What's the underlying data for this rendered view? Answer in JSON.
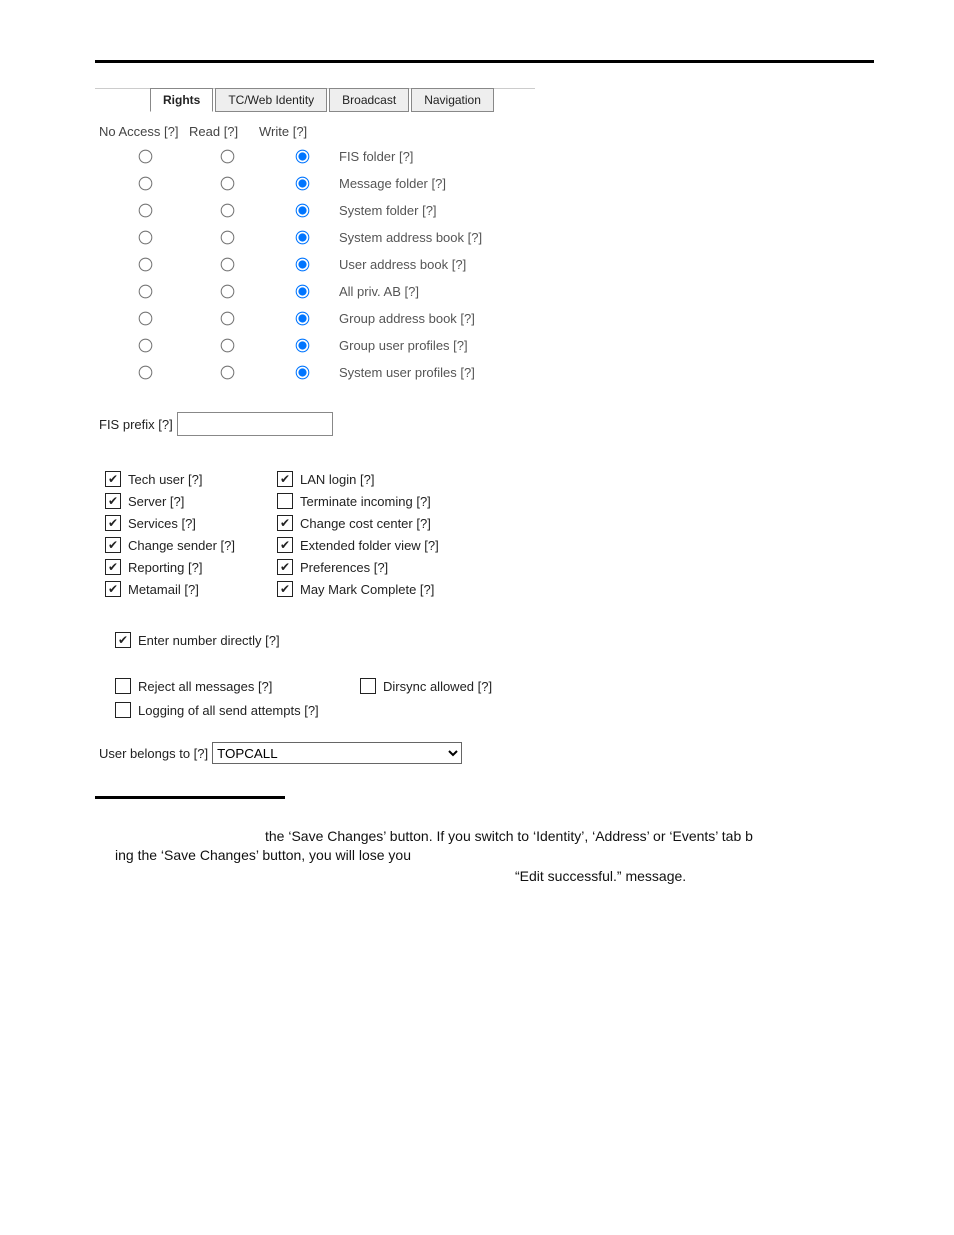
{
  "tabs": {
    "rights": "Rights",
    "identity": "TC/Web Identity",
    "broadcast": "Broadcast",
    "navigation": "Navigation"
  },
  "headers": {
    "no_access": "No Access [?]",
    "read": "Read [?]",
    "write": "Write [?]"
  },
  "rights_rows": [
    "FIS folder [?]",
    "Message folder [?]",
    "System folder [?]",
    "System address book [?]",
    "User address book [?]",
    "All priv. AB [?]",
    "Group address book [?]",
    "Group user profiles [?]",
    "System user profiles [?]"
  ],
  "fis_prefix_label": "FIS prefix [?]",
  "fis_prefix_value": "",
  "checks_left": [
    "Tech user [?]",
    "Server [?]",
    "Services [?]",
    "Change sender [?]",
    "Reporting [?]",
    "Metamail [?]"
  ],
  "checks_right": [
    {
      "label": "LAN login [?]",
      "checked": true
    },
    {
      "label": "Terminate incoming [?]",
      "checked": false
    },
    {
      "label": "Change cost center [?]",
      "checked": true
    },
    {
      "label": "Extended folder view [?]",
      "checked": true
    },
    {
      "label": "Preferences [?]",
      "checked": true
    },
    {
      "label": "May Mark Complete [?]",
      "checked": true
    }
  ],
  "enter_number": "Enter number directly [?]",
  "reject_all": "Reject all messages [?]",
  "dirsync": "Dirsync allowed [?]",
  "logging": "Logging of all send attempts [?]",
  "belongs_label": "User belongs to [?]",
  "belongs_value": "TOPCALL",
  "footer": {
    "l1": "the ‘Save Changes’ button. If you switch to ‘Identity’, ‘Address’ or ‘Events’ tab b",
    "l2": "ing the ‘Save Changes’ button, you will lose you",
    "l3": "“Edit successful.” message."
  }
}
